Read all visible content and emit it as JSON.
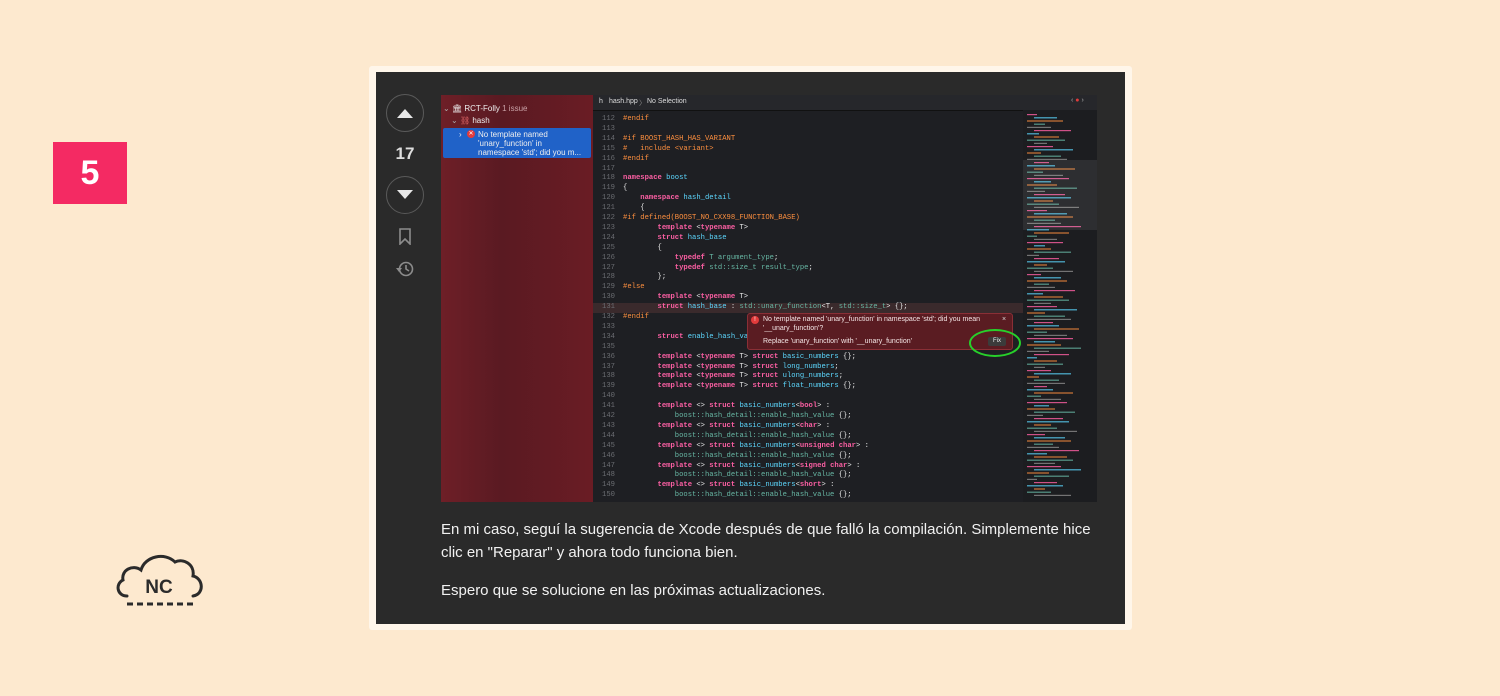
{
  "badge": "5",
  "logo": {
    "text": "NC"
  },
  "vote": {
    "count": "17"
  },
  "screenshot": {
    "nav": {
      "project": "RCT-Folly",
      "issues": "1 issue",
      "file": "hash",
      "error": [
        "No template named",
        "'unary_function' in",
        "namespace 'std'; did you m..."
      ]
    },
    "jumpbar": {
      "file": "hash.hpp",
      "sep": "〉",
      "selection": "No Selection"
    },
    "popup": {
      "line1": "No template named 'unary_function' in namespace 'std'; did you mean",
      "line2": "'__unary_function'?",
      "fix_text": "Replace 'unary_function' with '__unary_function'",
      "fix_button": "Fix"
    }
  },
  "answer": {
    "p1_line1": "En mi caso, seguí la sugerencia de Xcode después de que falló la compilación. Simplemente hice",
    "p1_line2": "clic en \"Reparar\" y ahora todo funciona bien.",
    "p2": "Espero que se solucione en las próximas actualizaciones."
  },
  "colors": {
    "background": "#fde9cf",
    "badge": "#f42a63",
    "card": "#2a2a2a",
    "selection": "#2062c8",
    "error": "#e23b3b",
    "annotation": "#27d02a"
  },
  "code_lines": [
    {
      "n": "112",
      "c": [
        [
          "pp",
          "#endif"
        ]
      ]
    },
    {
      "n": "113",
      "c": []
    },
    {
      "n": "114",
      "c": [
        [
          "pp",
          "#if BOOST_HASH_HAS_VARIANT"
        ]
      ]
    },
    {
      "n": "115",
      "c": [
        [
          "pp",
          "#   include <variant>"
        ]
      ]
    },
    {
      "n": "116",
      "c": [
        [
          "pp",
          "#endif"
        ]
      ]
    },
    {
      "n": "117",
      "c": []
    },
    {
      "n": "118",
      "c": [
        [
          "kw",
          "namespace "
        ],
        [
          "ty",
          "boost"
        ]
      ]
    },
    {
      "n": "119",
      "c": [
        [
          "tx",
          "{"
        ]
      ]
    },
    {
      "n": "120",
      "c": [
        [
          "kw",
          "    namespace "
        ],
        [
          "ty",
          "hash_detail"
        ]
      ]
    },
    {
      "n": "121",
      "c": [
        [
          "tx",
          "    {"
        ]
      ]
    },
    {
      "n": "122",
      "c": [
        [
          "pp",
          "#if defined(BOOST_NO_CXX98_FUNCTION_BASE)"
        ]
      ]
    },
    {
      "n": "123",
      "c": [
        [
          "kw",
          "        template "
        ],
        [
          "tx",
          "<"
        ],
        [
          "kw",
          "typename "
        ],
        [
          "tx",
          "T>"
        ]
      ]
    },
    {
      "n": "124",
      "c": [
        [
          "kw",
          "        struct "
        ],
        [
          "ty",
          "hash_base"
        ]
      ]
    },
    {
      "n": "125",
      "c": [
        [
          "tx",
          "        {"
        ]
      ]
    },
    {
      "n": "126",
      "c": [
        [
          "kw",
          "            typedef "
        ],
        [
          "tp",
          "T argument_type"
        ],
        [
          "tx",
          ";"
        ]
      ]
    },
    {
      "n": "127",
      "c": [
        [
          "kw",
          "            typedef "
        ],
        [
          "tp",
          "std::size_t result_type"
        ],
        [
          "tx",
          ";"
        ]
      ]
    },
    {
      "n": "128",
      "c": [
        [
          "tx",
          "        };"
        ]
      ]
    },
    {
      "n": "129",
      "c": [
        [
          "pp",
          "#else"
        ]
      ]
    },
    {
      "n": "130",
      "c": [
        [
          "kw",
          "        template "
        ],
        [
          "tx",
          "<"
        ],
        [
          "kw",
          "typename "
        ],
        [
          "tx",
          "T>"
        ]
      ]
    },
    {
      "n": "131",
      "c": [
        [
          "kw",
          "        struct "
        ],
        [
          "ty",
          "hash_base "
        ],
        [
          "tx",
          ": "
        ],
        [
          "tp",
          "std::unary_function"
        ],
        [
          "tx",
          "<T, "
        ],
        [
          "tp",
          "std::size_t"
        ],
        [
          "tx",
          "> {};"
        ]
      ],
      "hl": true
    },
    {
      "n": "132",
      "c": [
        [
          "pp",
          "#endif"
        ]
      ]
    },
    {
      "n": "133",
      "c": []
    },
    {
      "n": "134",
      "c": [
        [
          "kw",
          "        struct "
        ],
        [
          "ty",
          "enable_hash_va"
        ]
      ]
    },
    {
      "n": "135",
      "c": []
    },
    {
      "n": "136",
      "c": [
        [
          "kw",
          "        template "
        ],
        [
          "tx",
          "<"
        ],
        [
          "kw",
          "typename "
        ],
        [
          "tx",
          "T> "
        ],
        [
          "kw",
          "struct "
        ],
        [
          "ty",
          "basic_numbers"
        ],
        [
          "tx",
          " {};"
        ]
      ]
    },
    {
      "n": "137",
      "c": [
        [
          "kw",
          "        template "
        ],
        [
          "tx",
          "<"
        ],
        [
          "kw",
          "typename "
        ],
        [
          "tx",
          "T> "
        ],
        [
          "kw",
          "struct "
        ],
        [
          "ty",
          "long_numbers"
        ],
        [
          "tx",
          ";"
        ]
      ]
    },
    {
      "n": "138",
      "c": [
        [
          "kw",
          "        template "
        ],
        [
          "tx",
          "<"
        ],
        [
          "kw",
          "typename "
        ],
        [
          "tx",
          "T> "
        ],
        [
          "kw",
          "struct "
        ],
        [
          "ty",
          "ulong_numbers"
        ],
        [
          "tx",
          ";"
        ]
      ]
    },
    {
      "n": "139",
      "c": [
        [
          "kw",
          "        template "
        ],
        [
          "tx",
          "<"
        ],
        [
          "kw",
          "typename "
        ],
        [
          "tx",
          "T> "
        ],
        [
          "kw",
          "struct "
        ],
        [
          "ty",
          "float_numbers"
        ],
        [
          "tx",
          " {};"
        ]
      ]
    },
    {
      "n": "140",
      "c": []
    },
    {
      "n": "141",
      "c": [
        [
          "kw",
          "        template "
        ],
        [
          "tx",
          "<> "
        ],
        [
          "kw",
          "struct "
        ],
        [
          "ty",
          "basic_numbers"
        ],
        [
          "tx",
          "<"
        ],
        [
          "kw",
          "bool"
        ],
        [
          "tx",
          "> :"
        ]
      ]
    },
    {
      "n": "142",
      "c": [
        [
          "tp",
          "            boost::hash_detail::enable_hash_value"
        ],
        [
          "tx",
          " {};"
        ]
      ]
    },
    {
      "n": "143",
      "c": [
        [
          "kw",
          "        template "
        ],
        [
          "tx",
          "<> "
        ],
        [
          "kw",
          "struct "
        ],
        [
          "ty",
          "basic_numbers"
        ],
        [
          "tx",
          "<"
        ],
        [
          "kw",
          "char"
        ],
        [
          "tx",
          "> :"
        ]
      ]
    },
    {
      "n": "144",
      "c": [
        [
          "tp",
          "            boost::hash_detail::enable_hash_value"
        ],
        [
          "tx",
          " {};"
        ]
      ]
    },
    {
      "n": "145",
      "c": [
        [
          "kw",
          "        template "
        ],
        [
          "tx",
          "<> "
        ],
        [
          "kw",
          "struct "
        ],
        [
          "ty",
          "basic_numbers"
        ],
        [
          "tx",
          "<"
        ],
        [
          "kw",
          "unsigned char"
        ],
        [
          "tx",
          "> :"
        ]
      ]
    },
    {
      "n": "146",
      "c": [
        [
          "tp",
          "            boost::hash_detail::enable_hash_value"
        ],
        [
          "tx",
          " {};"
        ]
      ]
    },
    {
      "n": "147",
      "c": [
        [
          "kw",
          "        template "
        ],
        [
          "tx",
          "<> "
        ],
        [
          "kw",
          "struct "
        ],
        [
          "ty",
          "basic_numbers"
        ],
        [
          "tx",
          "<"
        ],
        [
          "kw",
          "signed char"
        ],
        [
          "tx",
          "> :"
        ]
      ]
    },
    {
      "n": "148",
      "c": [
        [
          "tp",
          "            boost::hash_detail::enable_hash_value"
        ],
        [
          "tx",
          " {};"
        ]
      ]
    },
    {
      "n": "149",
      "c": [
        [
          "kw",
          "        template "
        ],
        [
          "tx",
          "<> "
        ],
        [
          "kw",
          "struct "
        ],
        [
          "ty",
          "basic_numbers"
        ],
        [
          "tx",
          "<"
        ],
        [
          "kw",
          "short"
        ],
        [
          "tx",
          "> :"
        ]
      ]
    },
    {
      "n": "150",
      "c": [
        [
          "tp",
          "            boost::hash_detail::enable_hash_value"
        ],
        [
          "tx",
          " {};"
        ]
      ]
    }
  ]
}
